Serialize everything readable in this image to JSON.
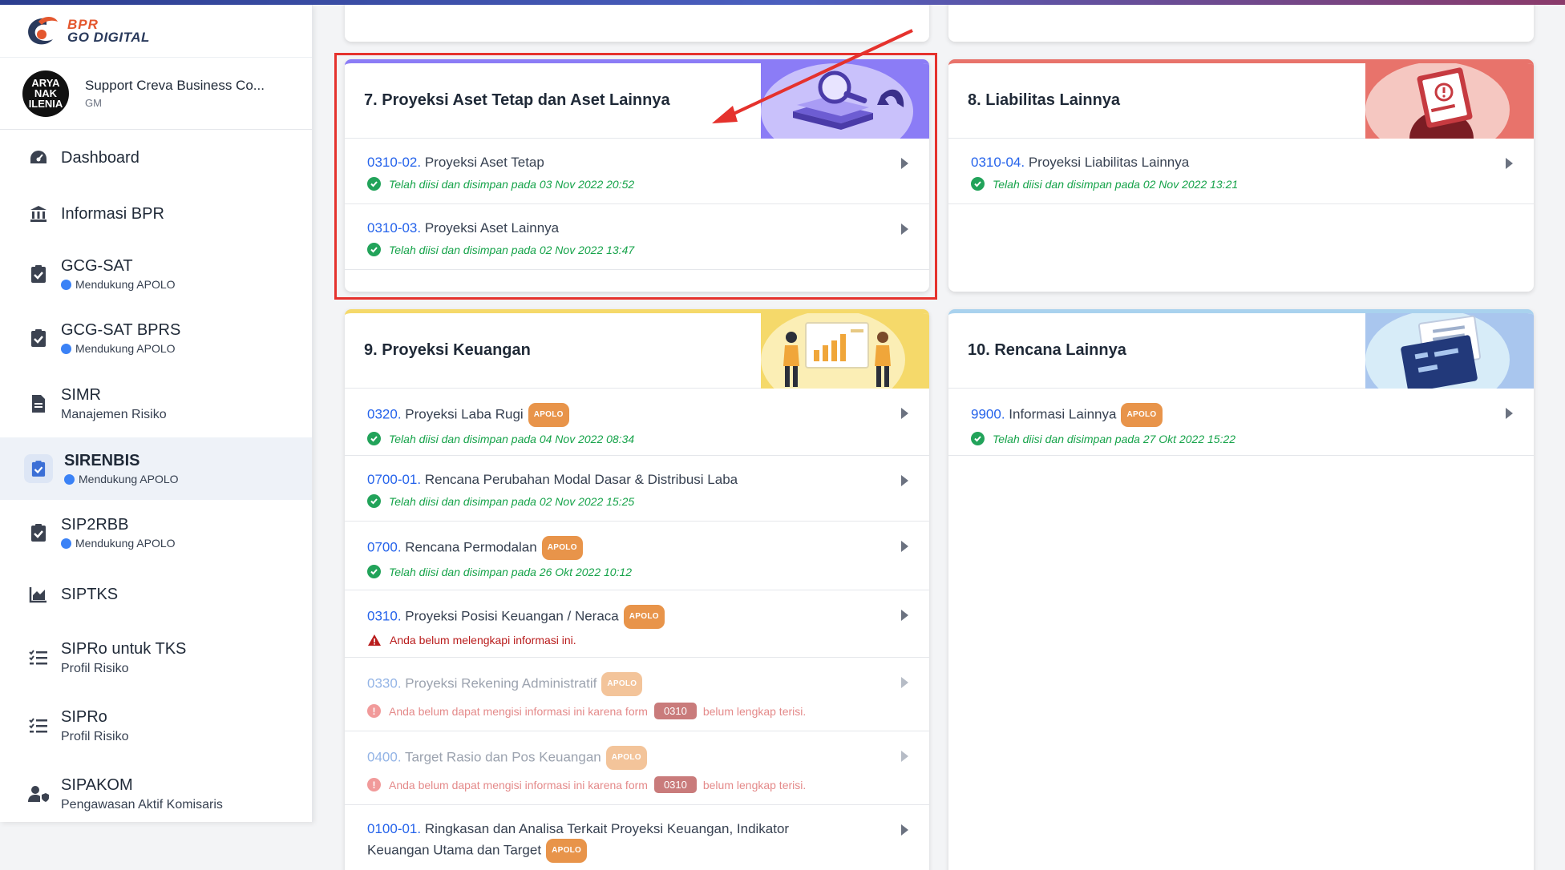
{
  "brand": {
    "line1": "BPR",
    "line2": "GO DIGITAL"
  },
  "user": {
    "avatar_text": "ARYA NAK ILENIA",
    "name": "Support Creva Business Co...",
    "role": "GM"
  },
  "sidebar": {
    "items": [
      {
        "label": "Dashboard",
        "icon": "speedometer-icon"
      },
      {
        "label": "Informasi BPR",
        "icon": "bank-icon"
      },
      {
        "label": "GCG-SAT",
        "badge": "Mendukung APOLO",
        "icon": "clipboard-check-icon"
      },
      {
        "label": "GCG-SAT BPRS",
        "badge": "Mendukung APOLO",
        "icon": "clipboard-check-icon"
      },
      {
        "label": "SIMR",
        "sub": "Manajemen Risiko",
        "icon": "document-icon"
      },
      {
        "label": "SIRENBIS",
        "badge": "Mendukung APOLO",
        "icon": "clipboard-check-icon",
        "active": true
      },
      {
        "label": "SIP2RBB",
        "badge": "Mendukung APOLO",
        "icon": "clipboard-check-icon"
      },
      {
        "label": "SIPTKS",
        "icon": "area-chart-icon"
      },
      {
        "label": "SIPRo untuk TKS",
        "sub": "Profil Risiko",
        "icon": "checklist-icon"
      },
      {
        "label": "SIPRo",
        "sub": "Profil Risiko",
        "icon": "checklist-icon"
      },
      {
        "label": "SIPAKOM",
        "sub": "Pengawasan Aktif Komisaris",
        "icon": "user-shield-icon"
      }
    ]
  },
  "cards": {
    "c7": {
      "title": "7. Proyeksi Aset Tetap dan Aset Lainnya",
      "color": "#8b7cf6",
      "rows": [
        {
          "code": "0310-02.",
          "name": " Proyeksi Aset Tetap",
          "status": "Telah diisi dan disimpan pada 03 Nov 2022 20:52"
        },
        {
          "code": "0310-03.",
          "name": " Proyeksi Aset Lainnya",
          "status": "Telah diisi dan disimpan pada 02 Nov 2022 13:47"
        }
      ]
    },
    "c8": {
      "title": "8. Liabilitas Lainnya",
      "color": "#e8736b",
      "rows": [
        {
          "code": "0310-04.",
          "name": " Proyeksi Liabilitas Lainnya",
          "status": "Telah diisi dan disimpan pada 02 Nov 2022 13:21"
        }
      ]
    },
    "c9": {
      "title": "9. Proyeksi Keuangan",
      "color": "#f5d96a",
      "rows": [
        {
          "code": "0320.",
          "name": " Proyeksi Laba Rugi",
          "badge": "APOLO",
          "status": "Telah diisi dan disimpan pada 04 Nov 2022 08:34"
        },
        {
          "code": "0700-01.",
          "name": " Rencana Perubahan Modal Dasar & Distribusi Laba",
          "status": "Telah diisi dan disimpan pada 02 Nov 2022 15:25"
        },
        {
          "code": "0700.",
          "name": " Rencana Permodalan",
          "badge": "APOLO",
          "status": "Telah diisi dan disimpan pada 26 Okt 2022 10:12"
        },
        {
          "code": "0310.",
          "name": " Proyeksi Posisi Keuangan / Neraca",
          "badge": "APOLO",
          "warning": "Anda belum melengkapi informasi ini."
        },
        {
          "code": "0330.",
          "name": " Proyeksi Rekening Administratif",
          "badge": "APOLO",
          "msg_pre": "Anda belum dapat mengisi informasi ini karena form",
          "form": "0310",
          "msg_post": "belum lengkap terisi."
        },
        {
          "code": "0400.",
          "name": " Target Rasio dan Pos Keuangan",
          "badge": "APOLO",
          "msg_pre": "Anda belum dapat mengisi informasi ini karena form",
          "form": "0310",
          "msg_post": "belum lengkap terisi."
        },
        {
          "code": "0100-01.",
          "name": " Ringkasan dan Analisa Terkait Proyeksi Keuangan, Indikator Keuangan Utama dan Target",
          "badge": "APOLO"
        }
      ]
    },
    "c10": {
      "title": "10. Rencana Lainnya",
      "color": "#a9d2ee",
      "rows": [
        {
          "code": "9900.",
          "name": " Informasi Lainnya",
          "badge": "APOLO",
          "status": "Telah diisi dan disimpan pada 27 Okt 2022 15:22"
        }
      ]
    }
  },
  "colors": {
    "highlight": "#e5322d",
    "link": "#2563eb",
    "success": "#16a34a",
    "apolo": "#e8944a"
  }
}
